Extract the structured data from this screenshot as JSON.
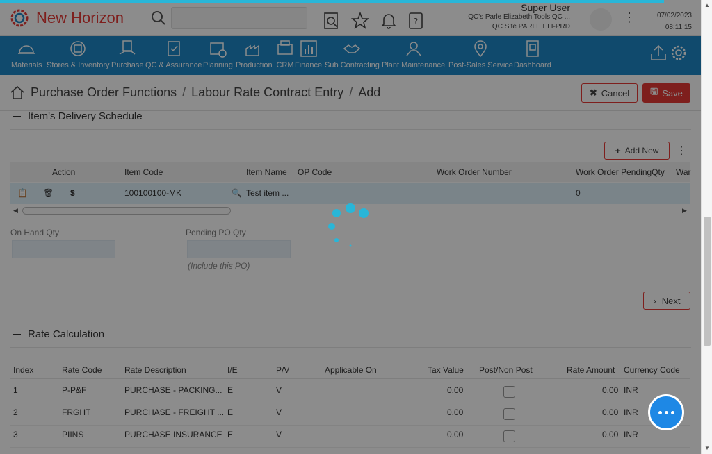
{
  "app": {
    "brand": "New Horizon"
  },
  "header": {
    "search_placeholder": "",
    "user": {
      "name": "Super User",
      "company": "QC's Parle Elizabeth Tools QC ...",
      "site": "QC Site PARLE ELI-PRD"
    },
    "date": "07/02/2023",
    "time": "08:11:15",
    "icons": [
      "doc-search-icon",
      "star-icon",
      "bell-icon",
      "help-book-icon"
    ]
  },
  "menu": {
    "items": [
      {
        "label": "Materials",
        "icon": "helmet-icon"
      },
      {
        "label": "Stores & Inventory",
        "icon": "inventory-icon"
      },
      {
        "label": "Purchase",
        "icon": "purchase-icon"
      },
      {
        "label": "QC & Assurance",
        "icon": "checklist-icon"
      },
      {
        "label": "Planning",
        "icon": "calendar-icon"
      },
      {
        "label": "Production",
        "icon": "factory-icon"
      },
      {
        "label": "CRM",
        "icon": "crm-icon"
      },
      {
        "label": "Finance",
        "icon": "chart-icon"
      },
      {
        "label": "Sub Contracting",
        "icon": "handshake-icon"
      },
      {
        "label": "Plant Maintenance",
        "icon": "maintenance-icon"
      },
      {
        "label": "Post-Sales Service",
        "icon": "location-icon"
      },
      {
        "label": "Dashboard",
        "icon": "dashboard-icon"
      }
    ]
  },
  "breadcrumb": {
    "items": [
      "Purchase Order Functions",
      "Labour Rate Contract Entry",
      "Add"
    ],
    "sep": "/"
  },
  "actions": {
    "cancel": "Cancel",
    "save": "Save"
  },
  "delivery": {
    "title": "Item's Delivery Schedule",
    "add_new": "Add New",
    "columns": [
      "Action",
      "Item Code",
      "Item Name",
      "OP Code",
      "Work Order Number",
      "Work Order PendingQty",
      "War"
    ],
    "rows": [
      {
        "item_code": "100100100-MK",
        "item_name": "Test item ...",
        "op_code": "",
        "work_order_number": "",
        "pending_qty": "0",
        "dollar": "$"
      }
    ],
    "on_hand_label": "On Hand Qty",
    "pending_po_label": "Pending PO Qty",
    "pending_hint": "(Include this PO)",
    "next": "Next"
  },
  "rate": {
    "title": "Rate Calculation",
    "columns": [
      "Index",
      "Rate Code",
      "Rate Description",
      "I/E",
      "P/V",
      "Applicable On",
      "Tax Value",
      "Post/Non Post",
      "Rate Amount",
      "Currency Code"
    ],
    "rows": [
      {
        "index": "1",
        "code": "P-P&F",
        "desc": "PURCHASE - PACKING...",
        "ie": "E",
        "pv": "V",
        "applicable": "",
        "tax": "0.00",
        "amount": "0.00",
        "currency": "INR"
      },
      {
        "index": "2",
        "code": "FRGHT",
        "desc": "PURCHASE - FREIGHT ...",
        "ie": "E",
        "pv": "V",
        "applicable": "",
        "tax": "0.00",
        "amount": "0.00",
        "currency": "INR"
      },
      {
        "index": "3",
        "code": "PIINS",
        "desc": "PURCHASE INSURANCE",
        "ie": "E",
        "pv": "V",
        "applicable": "",
        "tax": "0.00",
        "amount": "0.00",
        "currency": "INR"
      }
    ]
  },
  "colors": {
    "brand": "#e53935",
    "menu_bg": "#1e88c6",
    "accent": "#29b6d8",
    "chat": "#1e88e5"
  }
}
